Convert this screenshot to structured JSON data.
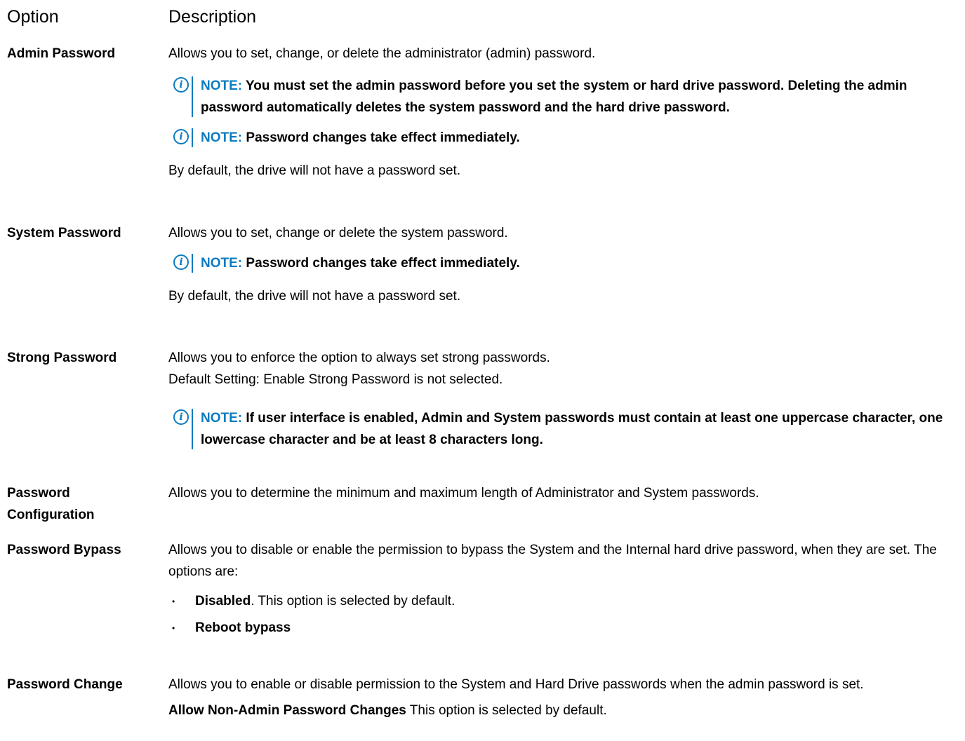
{
  "header": {
    "option": "Option",
    "description": "Description"
  },
  "rows": [
    {
      "label": "Admin Password",
      "text": "Allows you to set, change, or delete the administrator (admin) password.",
      "notes": [
        {
          "keyword": "NOTE:",
          "text": "You must set the admin password before you set the system or hard drive password. Deleting the admin password automatically deletes the system password and the hard drive password."
        },
        {
          "keyword": "NOTE:",
          "text": "Password changes take effect immediately."
        }
      ],
      "default": "By default, the drive will not have a password set."
    },
    {
      "label": "System Password",
      "text": "Allows you to set, change or delete the system password.",
      "notes": [
        {
          "keyword": "NOTE:",
          "text": "Password changes take effect immediately."
        }
      ],
      "default": "By default, the drive will not have a password set."
    },
    {
      "label": "Strong Password",
      "text": "Allows you to enforce the option to always set strong passwords.",
      "default": "Default Setting: Enable Strong Password is not selected.",
      "notes": [
        {
          "keyword": "NOTE:",
          "text": "If user interface is enabled, Admin and System passwords must contain at least one uppercase character, one lowercase character and be at least 8 characters long."
        }
      ]
    },
    {
      "label": "Password Configuration",
      "text": "Allows you to determine the minimum and maximum length of Administrator and System passwords."
    },
    {
      "label": "Password Bypass",
      "text": "Allows you to disable or enable the permission to bypass the System and the Internal hard drive password, when they are set. The options are:",
      "options": [
        {
          "bold": "Disabled",
          "rest": ". This option is selected by default."
        },
        {
          "bold": "Reboot bypass",
          "rest": ""
        }
      ]
    },
    {
      "label": "Password Change",
      "text": "Allows you to enable or disable permission to the System and Hard Drive passwords when the admin password is set.",
      "default_bold": "Allow Non-Admin Password Changes",
      "default_rest": " This option is selected by default."
    }
  ],
  "colors": {
    "note_accent": "#0b7bc0",
    "text": "#000000",
    "background": "#ffffff"
  },
  "icons": {
    "note": "info-circle-icon",
    "bullet": "bullet-dot-icon"
  }
}
